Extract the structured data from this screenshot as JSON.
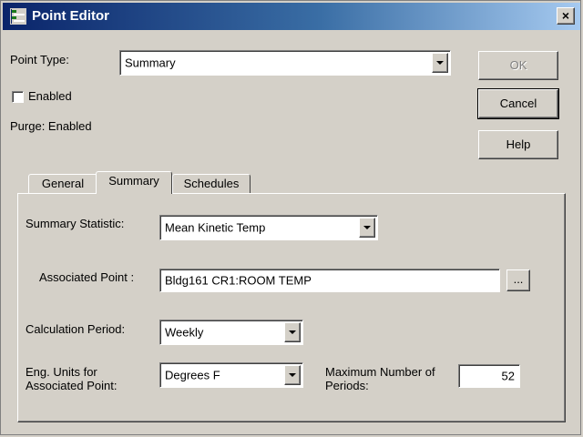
{
  "window": {
    "title": "Point Editor",
    "close_label": "×"
  },
  "point_type": {
    "label": "Point Type:",
    "value": "Summary"
  },
  "enabled": {
    "label": "Enabled",
    "checked": false
  },
  "purge": {
    "text": "Purge: Enabled"
  },
  "buttons": {
    "ok": "OK",
    "cancel": "Cancel",
    "help": "Help"
  },
  "tabs": [
    {
      "label": "General"
    },
    {
      "label": "Summary"
    },
    {
      "label": "Schedules"
    }
  ],
  "summary_tab": {
    "statistic": {
      "label": "Summary Statistic:",
      "value": "Mean Kinetic Temp"
    },
    "associated_point": {
      "label": "Associated Point :",
      "value": "Bldg161 CR1:ROOM TEMP",
      "browse_label": "..."
    },
    "calc_period": {
      "label": "Calculation Period:",
      "value": "Weekly"
    },
    "eng_units": {
      "label_line1": "Eng. Units for",
      "label_line2": "Associated Point:",
      "value": "Degrees F"
    },
    "max_periods": {
      "label_line1": "Maximum Number of",
      "label_line2": "Periods:",
      "value": "52"
    }
  },
  "icons": {
    "app": "point-editor-app-icon",
    "checkbox": "checkbox-icon",
    "dropdown": "chevron-down-icon"
  }
}
